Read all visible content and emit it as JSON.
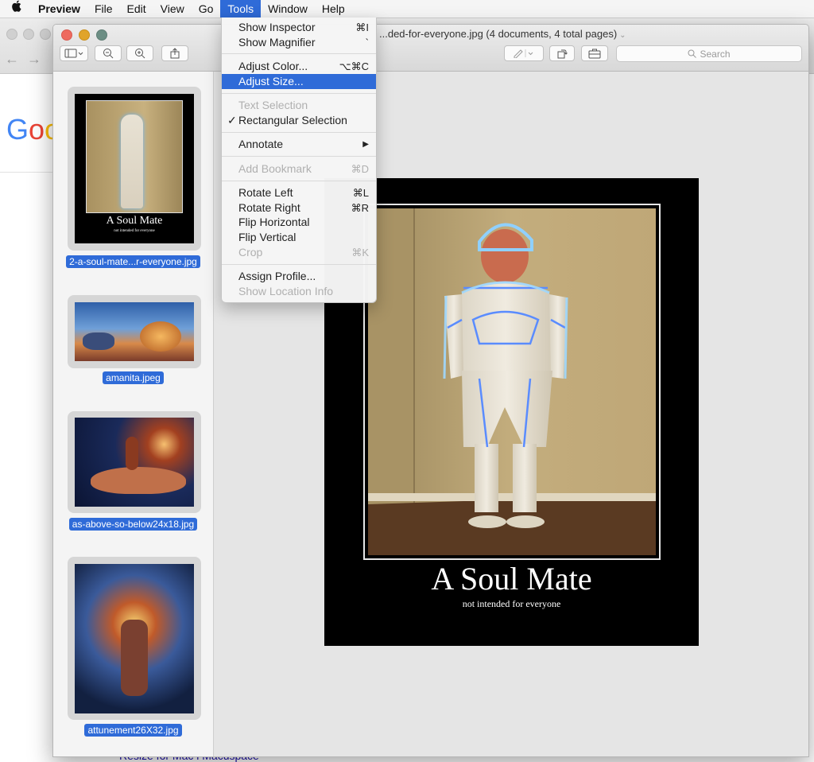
{
  "menubar": {
    "apple_glyph": "",
    "app_name": "Preview",
    "items": [
      "File",
      "Edit",
      "View",
      "Go",
      "Tools",
      "Window",
      "Help"
    ],
    "active": "Tools"
  },
  "browser": {
    "logo_part1": "G",
    "logo_part2": "o",
    "logo_part3": "o",
    "footer_text": "Resize for Mac i Macuspace"
  },
  "window": {
    "title": "...ded-for-everyone.jpg (4 documents, 4 total pages)",
    "search_placeholder": "Search"
  },
  "sidebar": {
    "items": [
      {
        "caption": "2-a-soul-mate...r-everyone.jpg",
        "thumb_caption_title": "A Soul Mate",
        "thumb_caption_sub": "not intended for everyone",
        "selected": true
      },
      {
        "caption": "amanita.jpeg",
        "selected": true
      },
      {
        "caption": "as-above-so-below24x18.jpg",
        "selected": true
      },
      {
        "caption": "attunement26X32.jpg",
        "selected": true
      }
    ]
  },
  "poster": {
    "title": "A Soul Mate",
    "subtitle": "not intended for everyone"
  },
  "tools_menu": {
    "items": [
      {
        "label": "Show Inspector",
        "shortcut": "⌘I",
        "disabled": false
      },
      {
        "label": "Show Magnifier",
        "shortcut": "`",
        "disabled": false
      },
      {
        "label": "Adjust Color...",
        "shortcut": "⌥⌘C",
        "disabled": false
      },
      {
        "label": "Adjust Size...",
        "shortcut": "",
        "disabled": false,
        "highlighted": true
      },
      {
        "label": "Text Selection",
        "shortcut": "",
        "disabled": true
      },
      {
        "label": "Rectangular Selection",
        "shortcut": "",
        "disabled": false,
        "checked": true
      },
      {
        "label": "Annotate",
        "shortcut": "▶",
        "disabled": false
      },
      {
        "label": "Add Bookmark",
        "shortcut": "⌘D",
        "disabled": true
      },
      {
        "label": "Rotate Left",
        "shortcut": "⌘L",
        "disabled": false
      },
      {
        "label": "Rotate Right",
        "shortcut": "⌘R",
        "disabled": false
      },
      {
        "label": "Flip Horizontal",
        "shortcut": "",
        "disabled": false
      },
      {
        "label": "Flip Vertical",
        "shortcut": "",
        "disabled": false
      },
      {
        "label": "Crop",
        "shortcut": "⌘K",
        "disabled": true
      },
      {
        "label": "Assign Profile...",
        "shortcut": "",
        "disabled": false
      },
      {
        "label": "Show Location Info",
        "shortcut": "",
        "disabled": true
      }
    ],
    "check_glyph": "✓"
  }
}
